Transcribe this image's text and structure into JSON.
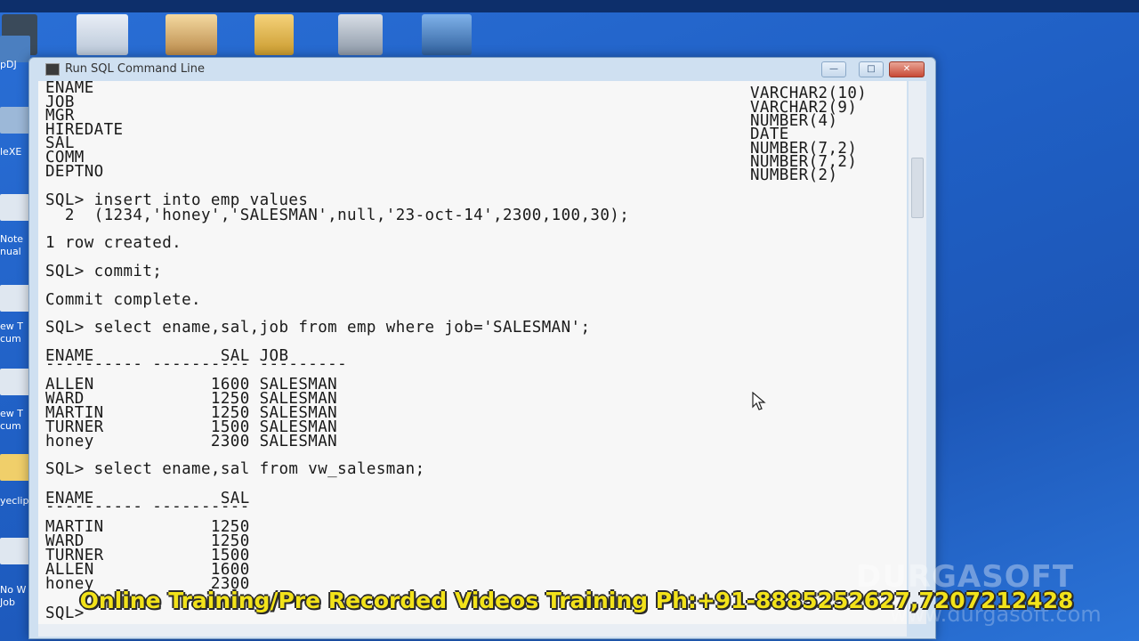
{
  "window": {
    "title": "Run SQL Command Line",
    "minimize": "—",
    "maximize": "□",
    "close": "✕"
  },
  "desktop": {
    "left_labels": [
      "pDJ",
      "leXE",
      "Note",
      "nual",
      "ew T",
      "cum",
      "ew T",
      "cum",
      "yeclip",
      "No W",
      "Job"
    ]
  },
  "console": {
    "describe_rows": [
      {
        "name": "ENAME",
        "type": "VARCHAR2(10)"
      },
      {
        "name": "JOB",
        "type": "VARCHAR2(9)"
      },
      {
        "name": "MGR",
        "type": "NUMBER(4)"
      },
      {
        "name": "HIREDATE",
        "type": "DATE"
      },
      {
        "name": "SAL",
        "type": "NUMBER(7,2)"
      },
      {
        "name": "COMM",
        "type": "NUMBER(7,2)"
      },
      {
        "name": "DEPTNO",
        "type": "NUMBER(2)"
      }
    ],
    "insert_cmd": "SQL> insert into emp values",
    "insert_line2": "  2  (1234,'honey','SALESMAN',null,'23-oct-14',2300,100,30);",
    "row_created": "1 row created.",
    "commit_cmd": "SQL> commit;",
    "commit_done": "Commit complete.",
    "select1_cmd": "SQL> select ename,sal,job from emp where job='SALESMAN';",
    "select1_header": "ENAME             SAL JOB",
    "select1_rule": "---------- ---------- ---------",
    "select1_rows": [
      "ALLEN            1600 SALESMAN",
      "WARD             1250 SALESMAN",
      "MARTIN           1250 SALESMAN",
      "TURNER           1500 SALESMAN",
      "honey            2300 SALESMAN"
    ],
    "select2_cmd": "SQL> select ename,sal from vw_salesman;",
    "select2_header": "ENAME             SAL",
    "select2_rule": "---------- ----------",
    "select2_rows": [
      "MARTIN           1250",
      "WARD             1250",
      "TURNER           1500",
      "ALLEN            1600",
      "honey            2300"
    ],
    "last_prompt": "SQL> "
  },
  "overlay": {
    "watermark": "DURGASOFT",
    "watermark_url": "www.durgasoft.com",
    "banner": "Online Training/Pre Recorded Videos Training Ph:+91-8885252627,7207212428"
  },
  "colors": {
    "desktop": "#2a6fd6",
    "console_bg": "#f7f7f7",
    "banner_text": "#f2e21a"
  }
}
